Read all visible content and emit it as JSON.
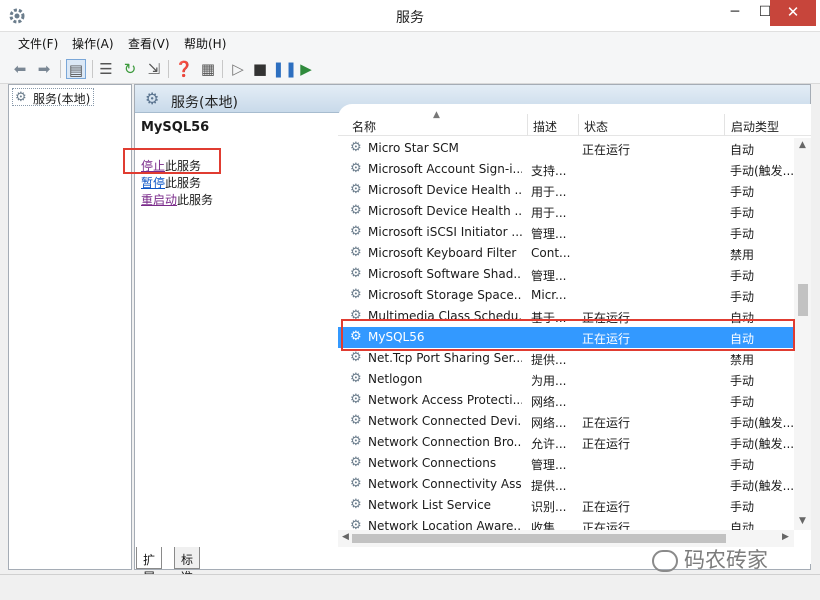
{
  "window": {
    "title": "服务",
    "minimize": "─",
    "maximize": "☐",
    "close": "✕"
  },
  "menu": [
    "文件(F)",
    "操作(A)",
    "查看(V)",
    "帮助(H)"
  ],
  "tree": {
    "root_label": "服务(本地)"
  },
  "pane": {
    "header_title": "服务(本地)"
  },
  "detail": {
    "service_name": "MySQL56",
    "actions": [
      {
        "link": "停止",
        "suffix": "此服务"
      },
      {
        "link": "暂停",
        "suffix": "此服务"
      },
      {
        "link": "重启动",
        "suffix": "此服务"
      }
    ]
  },
  "list": {
    "columns": [
      "名称",
      "描述",
      "状态",
      "启动类型"
    ],
    "rows": [
      [
        "Micro Star SCM",
        "",
        "正在运行",
        "自动"
      ],
      [
        "Microsoft Account Sign-i...",
        "支持...",
        "",
        "手动(触发..."
      ],
      [
        "Microsoft Device Health ...",
        "用于...",
        "",
        "手动"
      ],
      [
        "Microsoft Device Health ...",
        "用于...",
        "",
        "手动"
      ],
      [
        "Microsoft iSCSI Initiator ...",
        "管理...",
        "",
        "手动"
      ],
      [
        "Microsoft Keyboard Filter",
        "Cont...",
        "",
        "禁用"
      ],
      [
        "Microsoft Software Shad...",
        "管理...",
        "",
        "手动"
      ],
      [
        "Microsoft Storage Space...",
        "Micr...",
        "",
        "手动"
      ],
      [
        "Multimedia Class Schedu...",
        "基于...",
        "正在运行",
        "自动"
      ],
      [
        "MySQL56",
        "",
        "正在运行",
        "自动"
      ],
      [
        "Net.Tcp Port Sharing Ser...",
        "提供...",
        "",
        "禁用"
      ],
      [
        "Netlogon",
        "为用...",
        "",
        "手动"
      ],
      [
        "Network Access Protecti...",
        "网络...",
        "",
        "手动"
      ],
      [
        "Network Connected Devi...",
        "网络...",
        "正在运行",
        "手动(触发..."
      ],
      [
        "Network Connection Bro...",
        "允许...",
        "正在运行",
        "手动(触发..."
      ],
      [
        "Network Connections",
        "管理...",
        "",
        "手动"
      ],
      [
        "Network Connectivity Ass...",
        "提供...",
        "",
        "手动(触发..."
      ],
      [
        "Network List Service",
        "识别...",
        "正在运行",
        "手动"
      ],
      [
        "Network Location Aware...",
        "收集...",
        "正在运行",
        "自动"
      ]
    ],
    "selected_index": 9
  },
  "tabs": [
    "扩展",
    "标准"
  ],
  "watermark": "码农砖家",
  "colors": {
    "selection": "#3399ff",
    "highlight_box": "#e03c31",
    "close_button": "#c7453b"
  },
  "icons": [
    "gear-icon",
    "back-arrow-icon",
    "forward-arrow-icon",
    "play-icon",
    "stop-icon",
    "pause-icon",
    "resume-icon"
  ]
}
